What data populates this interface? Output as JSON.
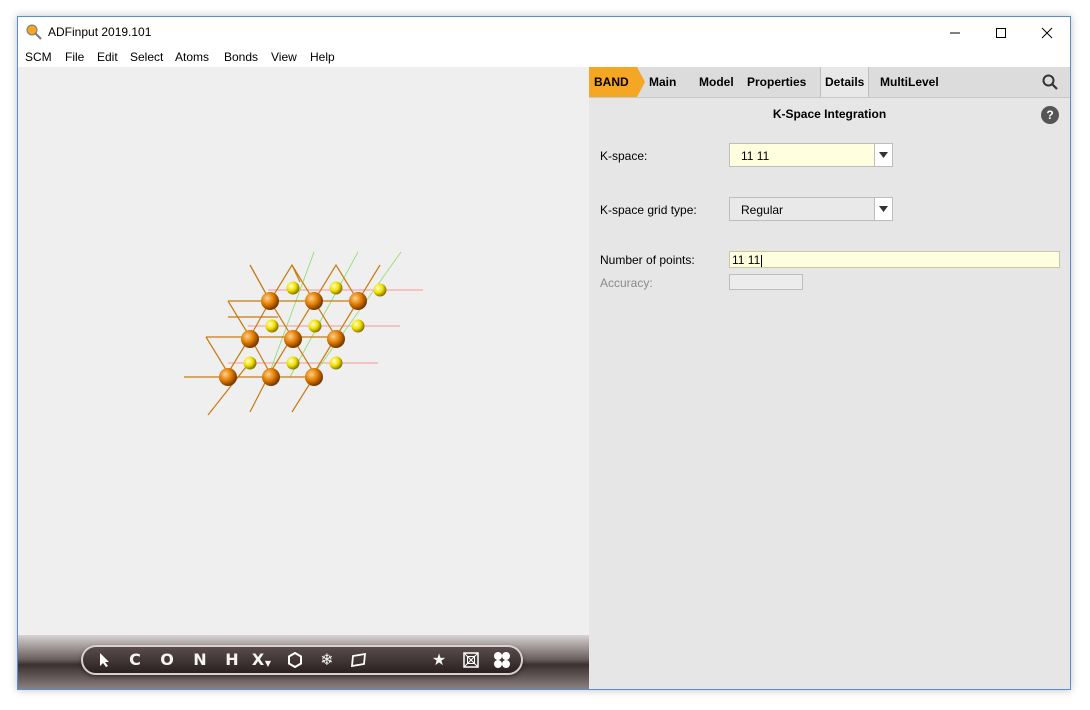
{
  "window": {
    "title": "ADFinput 2019.101"
  },
  "menu": [
    "SCM",
    "File",
    "Edit",
    "Select",
    "Atoms",
    "Bonds",
    "View",
    "Help"
  ],
  "tabs": [
    "BAND",
    "Main",
    "Model",
    "Properties",
    "Details",
    "MultiLevel"
  ],
  "panel": {
    "section_title": "K-Space Integration",
    "help": "?",
    "kspace": {
      "label": "K-space:",
      "value": "11 11"
    },
    "grid_type": {
      "label": "K-space grid type:",
      "value": "Regular"
    },
    "num_points": {
      "label": "Number of points:",
      "value": "11 11"
    },
    "accuracy": {
      "label": "Accuracy:",
      "value": ""
    }
  },
  "toolbar": [
    "C",
    "O",
    "N",
    "H",
    "X"
  ],
  "colors": {
    "band_tab": "#f5a623",
    "field_highlight": "#ffffe0",
    "gold_atom": "#e07b00",
    "sulfur_atom": "#f2e000"
  }
}
